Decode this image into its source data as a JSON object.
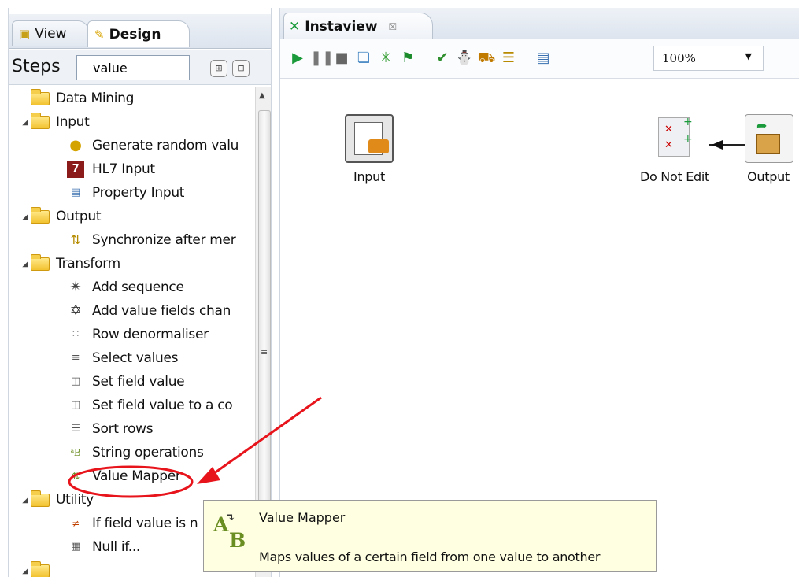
{
  "left_panel": {
    "tabs": [
      {
        "label": "View",
        "icon": "view-icon"
      },
      {
        "label": "Design",
        "icon": "pencil-icon"
      }
    ],
    "steps_label": "Steps",
    "search_value": "value",
    "tree": [
      {
        "label": "Data Mining",
        "type": "folder",
        "expanded": false
      },
      {
        "label": "Input",
        "type": "folder",
        "expanded": true
      },
      {
        "label": "Generate random valu",
        "type": "step",
        "icon": "dice-icon"
      },
      {
        "label": "HL7 Input",
        "type": "step",
        "icon": "hl7-icon"
      },
      {
        "label": "Property Input",
        "type": "step",
        "icon": "property-input-icon"
      },
      {
        "label": "Output",
        "type": "folder",
        "expanded": true
      },
      {
        "label": "Synchronize after mer",
        "type": "step",
        "icon": "synchronize-icon"
      },
      {
        "label": "Transform",
        "type": "folder",
        "expanded": true
      },
      {
        "label": "Add sequence",
        "type": "step",
        "icon": "add-sequence-icon"
      },
      {
        "label": "Add value fields chan",
        "type": "step",
        "icon": "add-value-fields-icon"
      },
      {
        "label": "Row denormaliser",
        "type": "step",
        "icon": "row-denormaliser-icon"
      },
      {
        "label": "Select values",
        "type": "step",
        "icon": "select-values-icon"
      },
      {
        "label": "Set field value",
        "type": "step",
        "icon": "set-field-value-icon"
      },
      {
        "label": "Set field value to a co",
        "type": "step",
        "icon": "set-field-constant-icon"
      },
      {
        "label": "Sort rows",
        "type": "step",
        "icon": "sort-rows-icon"
      },
      {
        "label": "String operations",
        "type": "step",
        "icon": "string-operations-icon"
      },
      {
        "label": "Value Mapper",
        "type": "step",
        "icon": "value-mapper-icon"
      },
      {
        "label": "Utility",
        "type": "folder",
        "expanded": true
      },
      {
        "label": "If field value is n",
        "type": "step",
        "icon": "if-null-icon"
      },
      {
        "label": "Null if...",
        "type": "step",
        "icon": "null-if-icon"
      }
    ]
  },
  "editor": {
    "tab_title": "Instaview",
    "zoom": "100%",
    "steps": [
      {
        "label": "Input",
        "icon": "input-step-icon"
      },
      {
        "label": "Do Not Edit",
        "icon": "do-not-edit-icon"
      },
      {
        "label": "Output",
        "icon": "output-step-icon"
      }
    ]
  },
  "tooltip": {
    "title": "Value Mapper",
    "description": "Maps values of a certain field from one value to another",
    "icon": "value-mapper-icon"
  },
  "colors": {
    "annotation_red": "#e8141c",
    "tooltip_bg": "#ffffe1",
    "run_green": "#1a9a3a"
  }
}
